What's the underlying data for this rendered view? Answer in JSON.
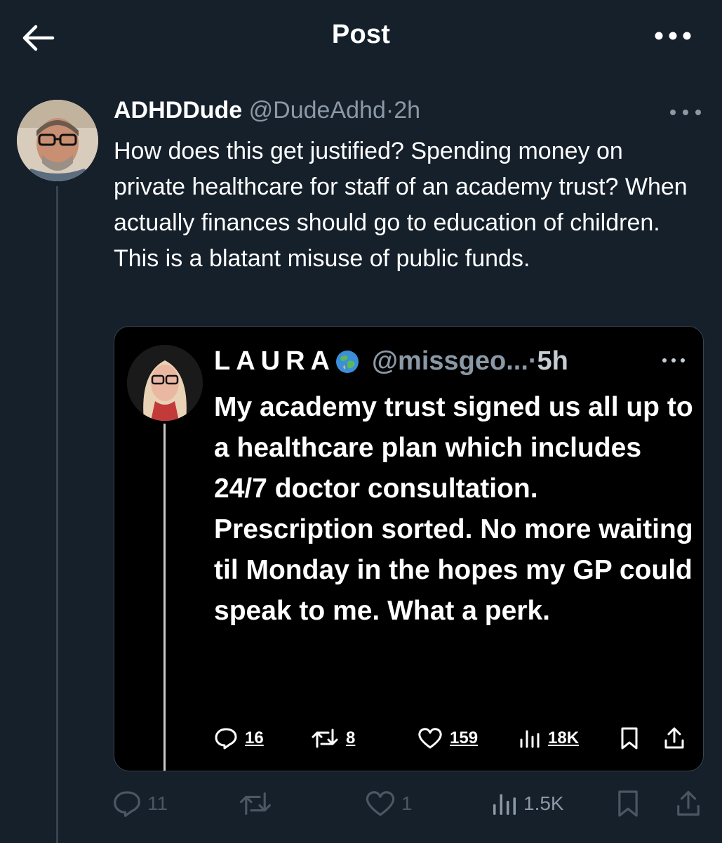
{
  "header": {
    "title": "Post"
  },
  "tweet": {
    "author_name": "ADHDDude",
    "author_handle": "@DudeAdhd",
    "separator": "·",
    "time": "2h",
    "text": "How does this get justified? Spending money on private healthcare for staff of an academy trust? When actually finances should go to education of children. This is a blatant misuse of public funds.",
    "stats": {
      "replies": "11",
      "likes": "1",
      "views": "1.5K"
    }
  },
  "quoted": {
    "author_name": "LAURA",
    "author_handle": "@missgeo...",
    "separator": "·",
    "time": "5h",
    "text": "My academy trust signed us all up to a healthcare plan which includes 24/7 doctor consultation. Prescription sorted. No more waiting til Monday in the hopes my GP could speak to me. What a perk.",
    "stats": {
      "replies": "16",
      "retweets": "8",
      "likes": "159",
      "views": "18K"
    }
  },
  "colors": {
    "background": "#15202b",
    "quote_background": "#000000",
    "secondary_text": "#8b98a5",
    "border": "#38444d"
  },
  "icons": [
    "back-arrow-icon",
    "more-icon",
    "reply-icon",
    "retweet-icon",
    "like-icon",
    "views-icon",
    "bookmark-icon",
    "share-icon",
    "globe-icon"
  ]
}
